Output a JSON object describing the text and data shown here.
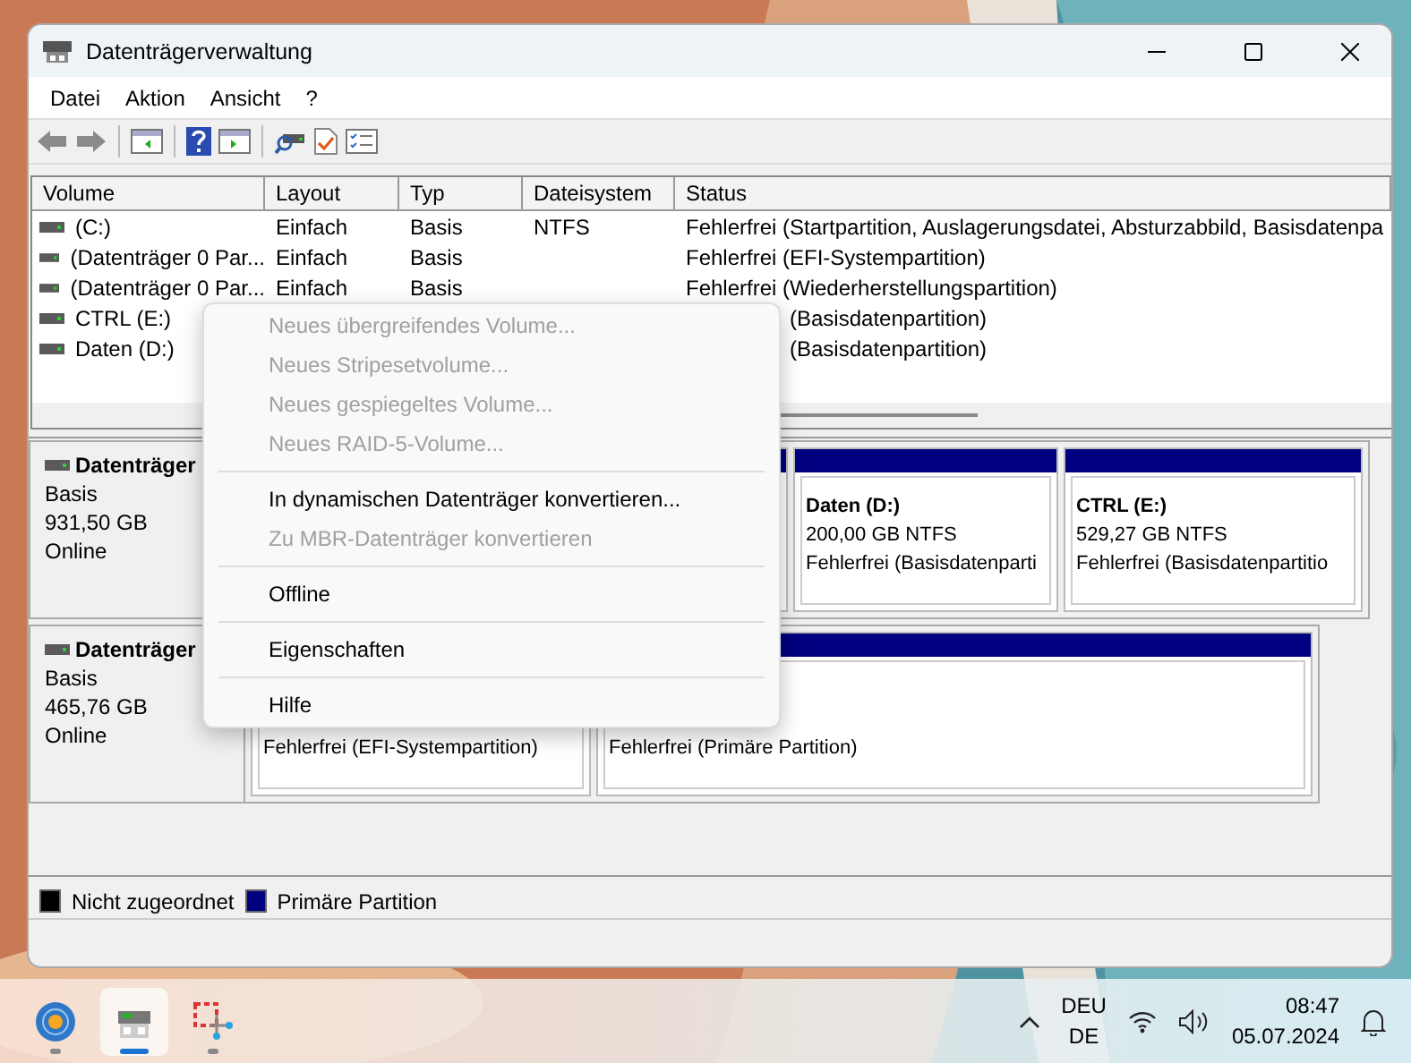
{
  "window": {
    "title": "Datenträgerverwaltung"
  },
  "menu_bar": [
    "Datei",
    "Aktion",
    "Ansicht",
    "?"
  ],
  "volume_list": {
    "columns": [
      "Volume",
      "Layout",
      "Typ",
      "Dateisystem",
      "Status"
    ],
    "rows": [
      {
        "volume": "(C:)",
        "layout": "Einfach",
        "type": "Basis",
        "file_system": "NTFS",
        "status": "Fehlerfrei (Startpartition, Auslagerungsdatei, Absturzabbild, Basisdatenpa"
      },
      {
        "volume": "(Datenträger 0 Par...",
        "layout": "Einfach",
        "type": "Basis",
        "status": "Fehlerfrei (EFI-Systempartition)"
      },
      {
        "volume": "(Datenträger 0 Par...",
        "layout": "Einfach",
        "type": "Basis",
        "status": "Fehlerfrei (Wiederherstellungspartition)"
      },
      {
        "volume": "CTRL (E:)",
        "status": "(Basisdatenpartition)",
        "covered": true
      },
      {
        "volume": "Daten (D:)",
        "status": "(Basisdatenpartition)",
        "covered": true
      }
    ]
  },
  "disks": [
    {
      "name": "Datenträger",
      "type": "Basis",
      "size": "931,50 GB",
      "state": "Online",
      "partitions": [
        {
          "kind": "covered"
        },
        {
          "kind": "partition",
          "name": "Daten  (D:)",
          "size": "200,00 GB NTFS",
          "status": "Fehlerfrei (Basisdatenparti"
        },
        {
          "kind": "partition",
          "name": "CTRL  (E:)",
          "size": "529,27 GB NTFS",
          "status": "Fehlerfrei (Basisdatenpartitio"
        }
      ]
    },
    {
      "name": "Datenträger",
      "type": "Basis",
      "size": "465,76 GB",
      "state": "Online",
      "partitions": [
        {
          "kind": "partition",
          "status": "Fehlerfrei (EFI-Systempartition)"
        },
        {
          "kind": "partition",
          "status": "Fehlerfrei (Primäre Partition)"
        }
      ]
    }
  ],
  "legend": [
    {
      "label": "Nicht zugeordnet",
      "color": "#000000"
    },
    {
      "label": "Primäre Partition",
      "color": "#000080"
    }
  ],
  "context_menu": [
    {
      "kind": "item",
      "label": "Neues übergreifendes Volume...",
      "disabled": true
    },
    {
      "kind": "item",
      "label": "Neues Stripesetvolume...",
      "disabled": true
    },
    {
      "kind": "item",
      "label": "Neues gespiegeltes Volume...",
      "disabled": true
    },
    {
      "kind": "item",
      "label": "Neues RAID-5-Volume...",
      "disabled": true
    },
    {
      "kind": "separator"
    },
    {
      "kind": "item",
      "label": "In dynamischen Datenträger konvertieren...",
      "disabled": false
    },
    {
      "kind": "item",
      "label": "Zu MBR-Datenträger konvertieren",
      "disabled": true
    },
    {
      "kind": "separator"
    },
    {
      "kind": "item",
      "label": "Offline",
      "disabled": false
    },
    {
      "kind": "separator"
    },
    {
      "kind": "item",
      "label": "Eigenschaften",
      "disabled": false
    },
    {
      "kind": "separator"
    },
    {
      "kind": "item",
      "label": "Hilfe",
      "disabled": false
    }
  ],
  "taskbar": {
    "apps": [
      {
        "kind": "globe",
        "selected": false
      },
      {
        "kind": "disk",
        "selected": true
      },
      {
        "kind": "snip",
        "selected": false
      }
    ],
    "language": "DEU",
    "layout": "DE",
    "time": "08:47",
    "date": "05.07.2024"
  }
}
